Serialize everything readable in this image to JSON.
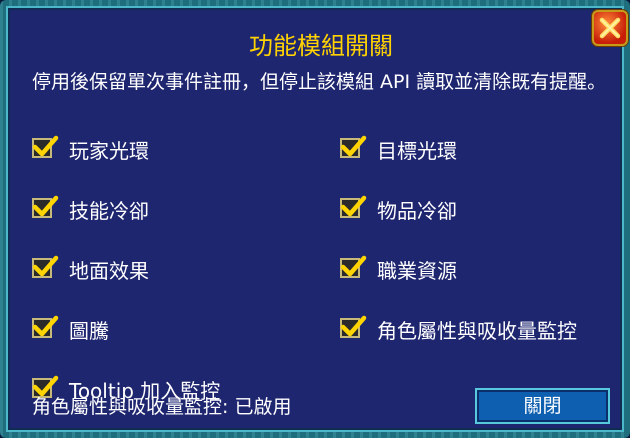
{
  "dialog": {
    "title": "功能模組開關",
    "description": "停用後保留單次事件註冊，但停止該模組 API 讀取並清除既有提醒。",
    "close_icon": "close-icon"
  },
  "features": [
    {
      "label": "玩家光環",
      "checked": true
    },
    {
      "label": "目標光環",
      "checked": true
    },
    {
      "label": "技能冷卻",
      "checked": true
    },
    {
      "label": "物品冷卻",
      "checked": true
    },
    {
      "label": "地面效果",
      "checked": true
    },
    {
      "label": "職業資源",
      "checked": true
    },
    {
      "label": "圖騰",
      "checked": true
    },
    {
      "label": "角色屬性與吸收量監控",
      "checked": true
    },
    {
      "label": "Tooltip 加入監控",
      "checked": true
    }
  ],
  "status_text": "角色屬性與吸收量監控: 已啟用",
  "close_button_label": "關閉",
  "colors": {
    "title": "#ffd200",
    "panel": "#1f2670",
    "check": "#ffd400",
    "border": "#4cb9c8"
  }
}
